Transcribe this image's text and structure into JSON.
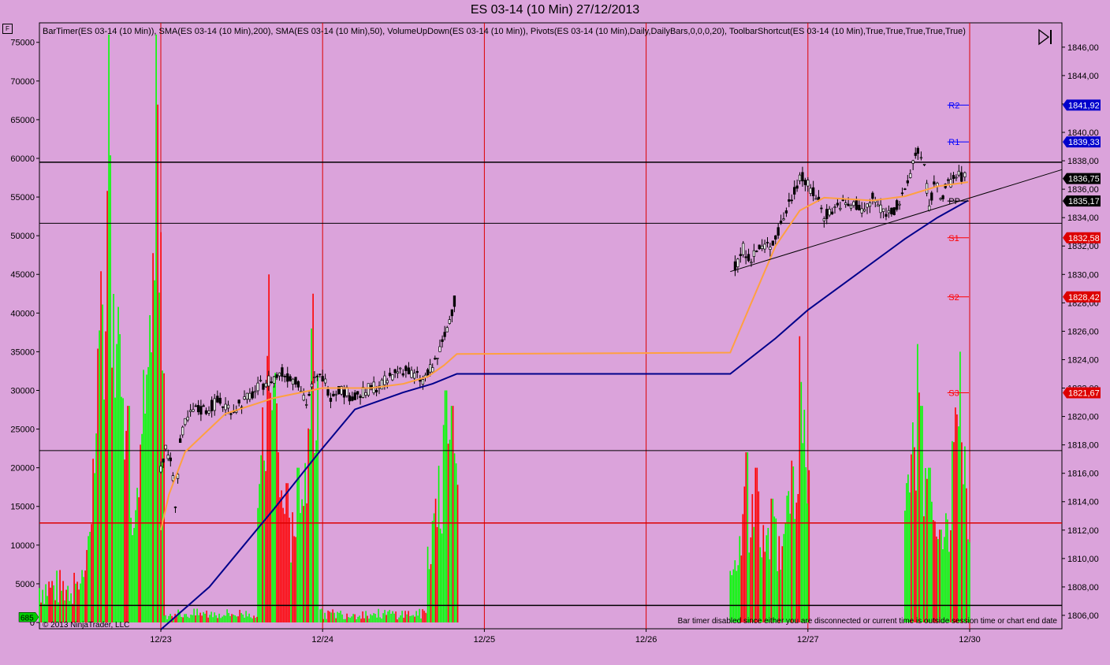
{
  "window": {
    "title": "ES 03-14 (10 Min)  27/12/2013"
  },
  "indicators_text": "BarTimer(ES 03-14 (10 Min)), SMA(ES 03-14 (10 Min),200), SMA(ES 03-14 (10 Min),50), VolumeUpDown(ES 03-14 (10 Min)), Pivots(ES 03-14 (10 Min),Daily,DailyBars,0,0,0,20), ToolbarShortcut(ES 03-14 (10 Min),True,True,True,True,True)",
  "copyright": "© 2013 NinjaTrader, LLC",
  "bar_timer_message": "Bar timer disabled since either you are disconnected or current time is outside session time or chart end date",
  "f_button": "F",
  "colors": {
    "background": "#dba3db",
    "up_volume": "#00ff00",
    "down_volume": "#ff0000",
    "sma50": "#ffa040",
    "sma200": "#00008b",
    "pivot_r": "#0000ff",
    "pivot_s": "#ff0000",
    "price": "#000000"
  },
  "chart_data": {
    "type": "candlestick-with-volume",
    "x_ticks": [
      "12/23",
      "12/24",
      "12/25",
      "12/26",
      "12/27",
      "12/30"
    ],
    "price_axis": {
      "ticks": [
        "1806,00",
        "1808,00",
        "1810,00",
        "1812,00",
        "1814,00",
        "1816,00",
        "1818,00",
        "1820,00",
        "1822,00",
        "1824,00",
        "1826,00",
        "1828,00",
        "1830,00",
        "1832,00",
        "1834,00",
        "1836,00",
        "1838,00",
        "1840,00",
        "1842,00",
        "1844,00",
        "1846,00"
      ],
      "range": [
        1805,
        1847.6
      ]
    },
    "volume_axis": {
      "ticks": [
        "0",
        "5000",
        "10000",
        "15000",
        "20000",
        "25000",
        "30000",
        "35000",
        "40000",
        "45000",
        "50000",
        "55000",
        "60000",
        "65000",
        "70000",
        "75000"
      ],
      "range": [
        0,
        76500
      ]
    },
    "price_markers": [
      {
        "label": "1841,92",
        "value": 1841.92,
        "color": "#0000cc"
      },
      {
        "label": "1839,33",
        "value": 1839.33,
        "color": "#0000cc"
      },
      {
        "label": "1836,75",
        "value": 1836.75,
        "color": "#000000"
      },
      {
        "label": "1835,17",
        "value": 1835.17,
        "color": "#000000"
      },
      {
        "label": "1832,58",
        "value": 1832.58,
        "color": "#dd0000"
      },
      {
        "label": "1828,42",
        "value": 1828.42,
        "color": "#dd0000"
      },
      {
        "label": "1821,67",
        "value": 1821.67,
        "color": "#dd0000"
      }
    ],
    "volume_marker": {
      "label": "685",
      "value": 685
    },
    "pivots": [
      {
        "label": "R2",
        "value": 1841.92,
        "color": "#0000ff"
      },
      {
        "label": "R1",
        "value": 1839.33,
        "color": "#0000ff"
      },
      {
        "label": "PP",
        "value": 1835.17,
        "color": "#000000"
      },
      {
        "label": "S1",
        "value": 1832.58,
        "color": "#ff0000"
      },
      {
        "label": "S2",
        "value": 1828.42,
        "color": "#ff0000"
      },
      {
        "label": "S3",
        "value": 1821.67,
        "color": "#ff0000"
      }
    ],
    "horizontal_lines": [
      {
        "value": 1837.9,
        "color": "#000000",
        "width": 1.5
      },
      {
        "value": 1833.6,
        "color": "#000000",
        "width": 1
      },
      {
        "value": 1817.6,
        "color": "#000000",
        "width": 1
      },
      {
        "value": 1812.5,
        "color": "#dd0000",
        "width": 1.5
      },
      {
        "value": 1806.7,
        "color": "#000000",
        "width": 1.5
      }
    ],
    "trendline": {
      "from": [
        1830.2,
        "12/26 late"
      ],
      "to": [
        1836.6,
        "12/30"
      ]
    },
    "price_path": [
      [
        0,
        1816.5
      ],
      [
        0.03,
        1817.6
      ],
      [
        0.06,
        1817
      ],
      [
        0.09,
        1814
      ],
      [
        0.12,
        1818.1
      ],
      [
        0.15,
        1819.5
      ],
      [
        0.2,
        1820.4
      ],
      [
        0.28,
        1820.5
      ],
      [
        0.35,
        1821
      ],
      [
        0.45,
        1820.5
      ],
      [
        0.55,
        1821.4
      ],
      [
        0.65,
        1822.5
      ],
      [
        0.75,
        1823
      ],
      [
        0.85,
        1822.5
      ],
      [
        0.9,
        1821
      ],
      [
        0.95,
        1822.5
      ],
      [
        1.0,
        1822.8
      ],
      [
        1.05,
        1821.5
      ],
      [
        1.1,
        1822
      ],
      [
        1.2,
        1821.3
      ],
      [
        1.3,
        1822
      ],
      [
        1.4,
        1822.5
      ],
      [
        1.48,
        1823.4
      ],
      [
        1.55,
        1823
      ],
      [
        1.62,
        1822.5
      ],
      [
        1.68,
        1823.5
      ],
      [
        1.74,
        1825
      ],
      [
        1.8,
        1827.5
      ],
      [
        1.83,
        1828.6
      ],
      [
        3.55,
        1830.5
      ],
      [
        3.6,
        1831.8
      ],
      [
        3.65,
        1831.2
      ],
      [
        3.7,
        1831.8
      ],
      [
        3.75,
        1832
      ],
      [
        3.8,
        1832.5
      ],
      [
        3.85,
        1834
      ],
      [
        3.9,
        1835.5
      ],
      [
        3.95,
        1837
      ],
      [
        4.0,
        1836.2
      ],
      [
        4.05,
        1835.5
      ],
      [
        4.1,
        1834.2
      ],
      [
        4.15,
        1834.5
      ],
      [
        4.2,
        1835
      ],
      [
        4.25,
        1834.8
      ],
      [
        4.3,
        1834.9
      ],
      [
        4.35,
        1834.5
      ],
      [
        4.4,
        1835.3
      ],
      [
        4.45,
        1834.7
      ],
      [
        4.5,
        1834.3
      ],
      [
        4.55,
        1834.8
      ],
      [
        4.6,
        1835.6
      ],
      [
        4.65,
        1838
      ],
      [
        4.68,
        1838.8
      ],
      [
        4.72,
        1837.5
      ],
      [
        4.75,
        1834.5
      ],
      [
        4.78,
        1836.5
      ],
      [
        4.82,
        1835.5
      ],
      [
        4.85,
        1836
      ],
      [
        4.9,
        1836.8
      ],
      [
        4.95,
        1836.9
      ],
      [
        4.99,
        1836.75
      ]
    ],
    "sma50": [
      [
        0,
        1812
      ],
      [
        0.05,
        1814.5
      ],
      [
        0.15,
        1817.5
      ],
      [
        0.4,
        1820.2
      ],
      [
        0.7,
        1821.3
      ],
      [
        1.0,
        1822
      ],
      [
        1.3,
        1822
      ],
      [
        1.5,
        1822.3
      ],
      [
        1.65,
        1822.8
      ],
      [
        1.75,
        1823.6
      ],
      [
        1.83,
        1824.4
      ],
      [
        3.52,
        1824.5
      ],
      [
        3.65,
        1828
      ],
      [
        3.8,
        1832
      ],
      [
        3.95,
        1834.5
      ],
      [
        4.1,
        1835.4
      ],
      [
        4.4,
        1835.2
      ],
      [
        4.6,
        1835.5
      ],
      [
        4.8,
        1836.2
      ],
      [
        4.99,
        1836.5
      ]
    ],
    "sma200": [
      [
        0,
        1805
      ],
      [
        0.3,
        1808
      ],
      [
        0.7,
        1813.5
      ],
      [
        0.98,
        1817.5
      ],
      [
        1.2,
        1820.5
      ],
      [
        1.5,
        1821.7
      ],
      [
        1.68,
        1822.3
      ],
      [
        1.83,
        1823
      ],
      [
        3.52,
        1823
      ],
      [
        3.8,
        1825.5
      ],
      [
        4.0,
        1827.5
      ],
      [
        4.3,
        1830
      ],
      [
        4.6,
        1832.5
      ],
      [
        4.8,
        1834
      ],
      [
        4.99,
        1835.2
      ]
    ],
    "volume_sessions": [
      {
        "from": -0.75,
        "to": 0.02,
        "peaks": [
          [
            -0.4,
            18000
          ],
          [
            -0.32,
            76000
          ],
          [
            -0.27,
            32000
          ],
          [
            -0.2,
            28000
          ],
          [
            -0.1,
            27000
          ],
          [
            -0.05,
            36000
          ],
          [
            -0.03,
            76000
          ],
          [
            0.0,
            18000
          ]
        ]
      },
      {
        "from": 0.6,
        "to": 0.98,
        "peaks": [
          [
            0.67,
            45000
          ],
          [
            0.72,
            22000
          ],
          [
            0.78,
            18000
          ],
          [
            0.85,
            20000
          ],
          [
            0.94,
            42500
          ]
        ]
      },
      {
        "from": 1.65,
        "to": 1.84,
        "peaks": [
          [
            1.7,
            16000
          ],
          [
            1.76,
            30000
          ],
          [
            1.8,
            28000
          ],
          [
            1.83,
            15000
          ]
        ]
      },
      {
        "from": 3.52,
        "to": 4.01,
        "peaks": [
          [
            3.62,
            22000
          ],
          [
            3.68,
            20000
          ],
          [
            3.78,
            16000
          ],
          [
            3.9,
            17500
          ],
          [
            3.95,
            37000
          ],
          [
            3.98,
            20000
          ]
        ]
      },
      {
        "from": 4.6,
        "to": 5.0,
        "peaks": [
          [
            4.68,
            36000
          ],
          [
            4.7,
            28000
          ],
          [
            4.75,
            20000
          ],
          [
            4.82,
            12000
          ],
          [
            4.9,
            14000
          ],
          [
            4.94,
            35000
          ],
          [
            4.98,
            8000
          ]
        ]
      }
    ]
  }
}
